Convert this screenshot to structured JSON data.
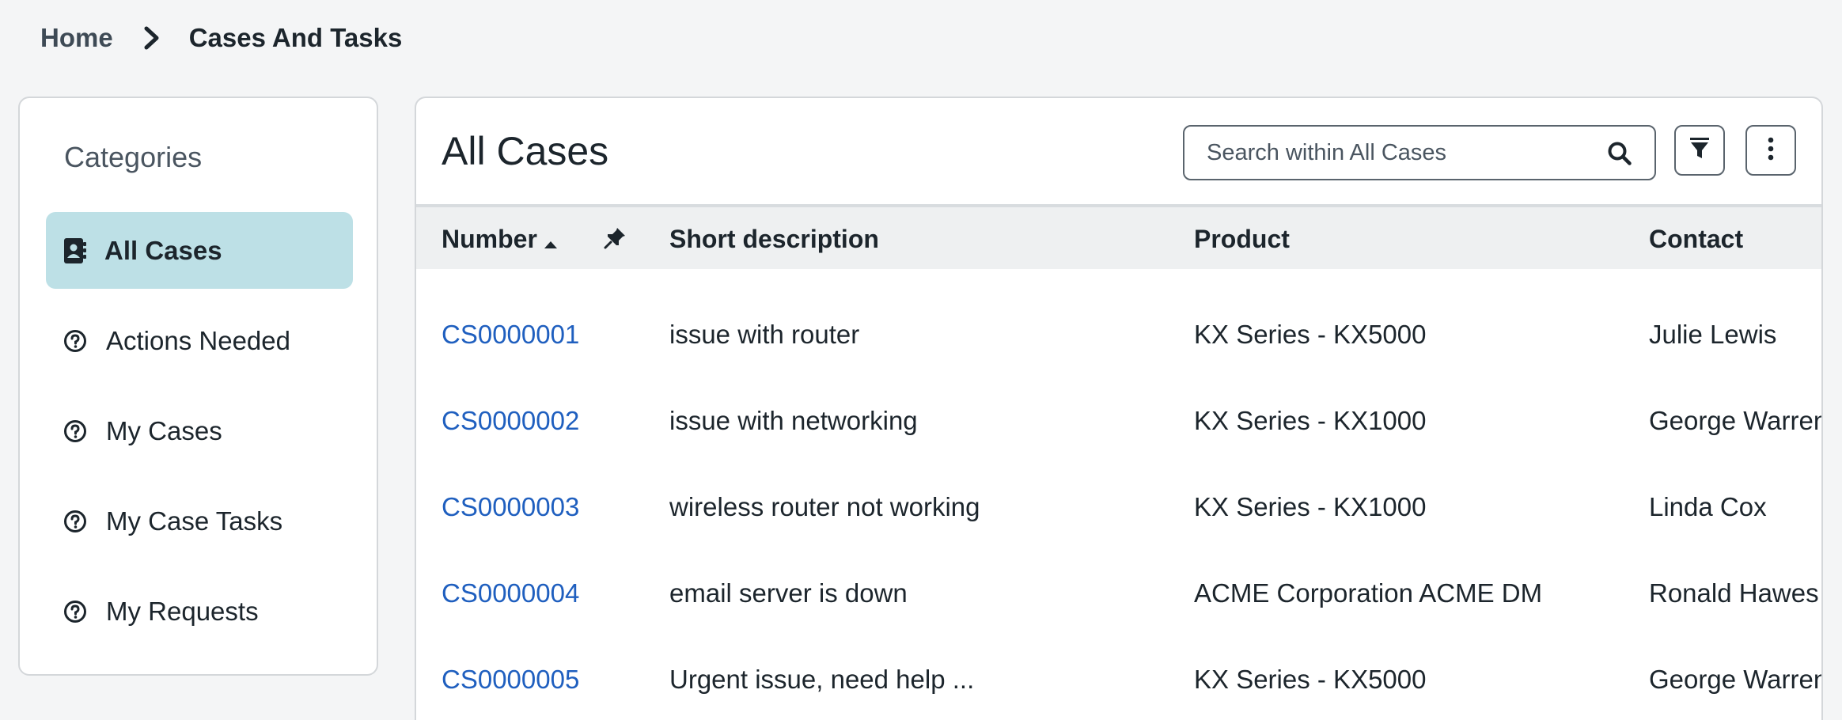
{
  "breadcrumb": {
    "home": "Home",
    "current": "Cases And Tasks"
  },
  "sidebar": {
    "title": "Categories",
    "items": [
      {
        "label": "All Cases",
        "icon": "contact-book-icon",
        "active": true
      },
      {
        "label": "Actions Needed",
        "icon": "question-circle-icon"
      },
      {
        "label": "My Cases",
        "icon": "question-circle-icon"
      },
      {
        "label": "My Case Tasks",
        "icon": "question-circle-icon"
      },
      {
        "label": "My Requests",
        "icon": "question-circle-icon"
      }
    ]
  },
  "main": {
    "title": "All Cases",
    "search_placeholder": "Search within All Cases",
    "columns": [
      "Number",
      "Short description",
      "Product",
      "Contact"
    ],
    "rows": [
      {
        "number": "CS0000001",
        "description": "issue with router",
        "product": "KX Series - KX5000",
        "contact": "Julie Lewis"
      },
      {
        "number": "CS0000002",
        "description": "issue with networking",
        "product": "KX Series - KX1000",
        "contact": "George Warren"
      },
      {
        "number": "CS0000003",
        "description": "wireless router not working",
        "product": "KX Series - KX1000",
        "contact": "Linda Cox"
      },
      {
        "number": "CS0000004",
        "description": "email server is down",
        "product": "ACME Corporation ACME DM",
        "contact": "Ronald Hawes"
      },
      {
        "number": "CS0000005",
        "description": "Urgent issue, need help ...",
        "product": "KX Series - KX5000",
        "contact": "George Warren"
      }
    ]
  },
  "colors": {
    "link": "#1f5fbf",
    "active_category_bg": "#bde0e6",
    "page_bg": "#f4f5f6"
  }
}
